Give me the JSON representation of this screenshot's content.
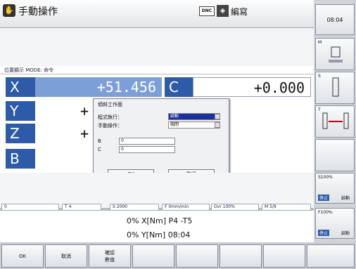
{
  "header": {
    "title": "手動操作",
    "dnc": "DNC",
    "edit": "編寫"
  },
  "clock": "08:04",
  "position_header": "位置顯示 MODE: 命令",
  "axes": [
    {
      "label": "X",
      "value": "+51.456"
    },
    {
      "label": "C",
      "value": "+0.000"
    },
    {
      "label": "Y",
      "value": "+"
    },
    {
      "label": "Z",
      "value": "+"
    },
    {
      "label": "B",
      "value": ""
    }
  ],
  "dialog": {
    "title": "傾斜工作面",
    "program_run_label": "程式執行：",
    "program_run_value": "啟動",
    "manual_label": "手動操作：",
    "manual_value": "關閉",
    "b_label": "B",
    "b_value": "0",
    "c_label": "C",
    "c_value": "0",
    "ok": "OK",
    "cancel": "取消"
  },
  "status_bar": {
    "item0": "0",
    "tool": "T 4",
    "speed": "S 2000",
    "feed": "F 0mm/min",
    "override": "Ovr 100%",
    "m": "M 5/9"
  },
  "lines": [
    "0% X[Nm] P4  -T5",
    "0% Y[Nm] 08:04"
  ],
  "side": {
    "s100": "S100%",
    "stop1": "停止",
    "active1": "啟動",
    "f100": "F100%",
    "stop2": "停止",
    "active2": "啟動",
    "m_label": "M",
    "s_label": "S",
    "t_label": "T"
  },
  "softkeys": [
    "OK",
    "取消",
    "確認\n數值",
    "",
    "",
    "",
    "",
    ""
  ]
}
